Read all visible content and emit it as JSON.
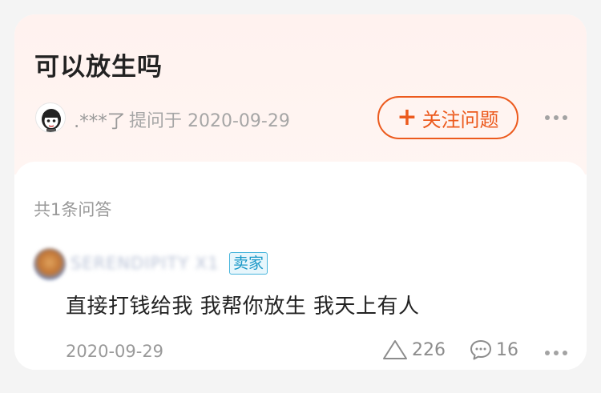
{
  "question": {
    "title": "可以放生吗",
    "asker_name": ".***了",
    "asked_at": "提问于 2020-09-29",
    "follow_label": "关注问题",
    "follow_icon": "plus-icon",
    "more_icon": "more-dots-icon"
  },
  "answers": {
    "count_label": "共1条问答",
    "items": [
      {
        "username": "SERENDIPITY X1",
        "badge": "卖家",
        "text": "直接打钱给我 我帮你放生 我天上有人",
        "date": "2020-09-29",
        "likes": "226",
        "comments": "16",
        "like_icon": "triangle-like-icon",
        "comment_icon": "speech-bubble-icon"
      }
    ]
  },
  "colors": {
    "accent": "#ec5a1d",
    "question_bg": "#fff2ef",
    "badge_border": "#47b5dc",
    "badge_text": "#1a98c7"
  }
}
